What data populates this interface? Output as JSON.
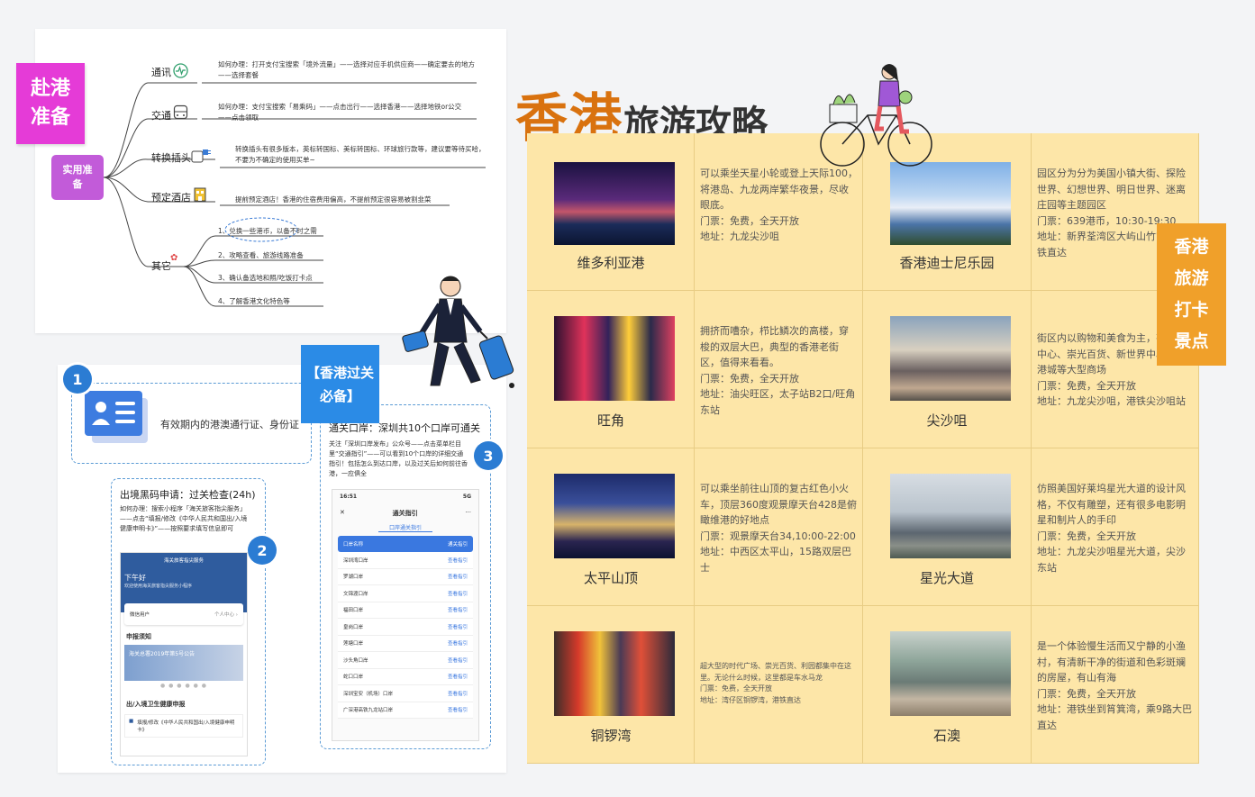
{
  "prep": {
    "sticky": "赴港准备",
    "center": "实用准备",
    "branches": [
      {
        "label": "通讯",
        "icon": "chart-line-icon",
        "desc": "如何办理：打开支付宝搜索「境外流量」——选择对应手机供应商——确定要去的地方——选择套餐"
      },
      {
        "label": "交通",
        "icon": "bus-icon",
        "desc": "如何办理：支付宝搜索「易乘码」——点击出行——选择香港——选择地铁or公交——点击领取"
      },
      {
        "label": "转换插头",
        "icon": "plug-icon",
        "desc": "转换插头有很多版本，英标转国标、美标转国标、环球旅行款等，建议要等待买哈，不要为不确定的使用买单~"
      },
      {
        "label": "预定酒店",
        "icon": "hotel-icon",
        "desc": "提前预定酒店！香港的住宿费用偏高，不提前预定很容易被割韭菜"
      },
      {
        "label": "其它",
        "icon": "ribbon-icon",
        "items": [
          "1、兑换一些港币，以备不时之需",
          "2、攻略查看、旅游线路准备",
          "3、确认备选地和照/吃饭打卡点",
          "4、了解香港文化特色等"
        ]
      }
    ]
  },
  "customs": {
    "sticky": "【香港过关必备】",
    "step1": {
      "num": "1",
      "text": "有效期内的港澳通行证、身份证"
    },
    "step2": {
      "num": "2",
      "title": "出境黑码申请：过关检查(24h)",
      "desc": "如何办理：搜索小程序「海关旅客指尖服务」——点击“填报/修改《中华人民共和国出/入境健康申明卡》”——按照要求填写信息即可",
      "app_header": "海关旅客指尖服务",
      "greeting": "下午好",
      "greeting_sub": "欢迎使用海关旅客指尖服务小程序",
      "user": "微信用户",
      "user_link": "个人中心 ›",
      "notice_title": "申报须知",
      "banner_text": "海关总署2019年第5号公告",
      "declare_title": "出/入境卫生健康申报",
      "declare_item": "填报/修改《中华人民共和国出/入境健康申明卡》"
    },
    "step3": {
      "num": "3",
      "title": "通关口岸：深圳共10个口岸可通关",
      "desc": "关注「深圳口岸发布」公众号——点击菜单栏目里“交通指引”——可以看到10个口岸的详细交通指引！包括怎么到达口岸，以及过关后如何前往香港，一应俱全",
      "phone_time": "16:51",
      "phone_signal": "5G",
      "phone_title": "通关指引",
      "phone_subtitle": "口岸通关指引",
      "head_left": "口岸名称",
      "head_right": "通关指引",
      "rows": [
        [
          "深圳湾口岸",
          "查看指引"
        ],
        [
          "罗湖口岸",
          "查看指引"
        ],
        [
          "文锦渡口岸",
          "查看指引"
        ],
        [
          "福田口岸",
          "查看指引"
        ],
        [
          "皇岗口岸",
          "查看指引"
        ],
        [
          "莲塘口岸",
          "查看指引"
        ],
        [
          "沙头角口岸",
          "查看指引"
        ],
        [
          "蛇口口岸",
          "查看指引"
        ],
        [
          "深圳宝安（机场）口岸",
          "查看指引"
        ],
        [
          "广深港高铁九龙站口岸",
          "查看指引"
        ]
      ]
    }
  },
  "title": {
    "part1": "香港",
    "part2": "旅游攻略"
  },
  "side_sticky": "香港旅游打卡景点",
  "spots": [
    {
      "name": "维多利亚港",
      "photo_icon": "harbour-photo",
      "desc": "可以乘坐天星小轮或登上天际100，将港岛、九龙两岸繁华夜景，尽收眼底。\n门票：免费，全天开放\n地址：九龙尖沙咀"
    },
    {
      "name": "香港迪士尼乐园",
      "photo_icon": "castle-photo",
      "desc": "园区分为分为美国小镇大街、探险世界、幻想世界、明日世界、迷离庄园等主题园区\n门票：639港币，10:30-19:30\n地址：新界荃湾区大屿山竹篙湾地铁直达"
    },
    {
      "name": "旺角",
      "photo_icon": "neon-street-photo",
      "desc": "拥挤而嘈杂，栉比鳞次的高楼，穿梭的双层大巴，典型的香港老街区，值得来看看。\n门票：免费，全天开放\n地址：油尖旺区，太子站B2口/旺角东站"
    },
    {
      "name": "尖沙咀",
      "photo_icon": "busy-street-photo",
      "desc": "街区内以购物和美食为主，有海港中心、崇光百货、新世界中心、海港城等大型商场\n门票：免费，全天开放\n地址：九龙尖沙咀，港铁尖沙咀站"
    },
    {
      "name": "太平山顶",
      "photo_icon": "night-view-photo",
      "desc": "可以乘坐前往山顶的复古红色小火车，顶层360度观景摩天台428是俯瞰维港的好地点\n门票：观景摩天台34,10:00-22:00\n地址：中西区太平山，15路双层巴士"
    },
    {
      "name": "星光大道",
      "photo_icon": "statue-photo",
      "desc": "仿照美国好莱坞星光大道的设计风格，不仅有雕塑，还有很多电影明星和制片人的手印\n门票：免费，全天开放\n地址：九龙尖沙咀星光大道，尖沙东站"
    },
    {
      "name": "铜锣湾",
      "photo_icon": "signboard-street-photo",
      "desc": "超大型的时代广场、崇光百货、利园都集中在这里。无论什么时候，这里都是车水马龙\n门票：免费，全天开放\n地址：湾仔区铜锣湾，港铁直达"
    },
    {
      "name": "石澳",
      "photo_icon": "village-lane-photo",
      "desc": "是一个体验慢生活而又宁静的小渔村，有清新干净的街道和色彩斑斓的房屋，有山有海\n门票：免费，全天开放\n地址：港铁坐到筲箕湾，乘9路大巴直达"
    }
  ],
  "colors": {
    "title_orange": "#d9720f",
    "grid_bg": "#fde6a8",
    "sticky_pink": "#e53bd7",
    "sticky_purple": "#c25bd9",
    "sticky_blue": "#2b8be6",
    "sticky_orange": "#f0a02a",
    "accent_blue": "#2b7cd3"
  }
}
